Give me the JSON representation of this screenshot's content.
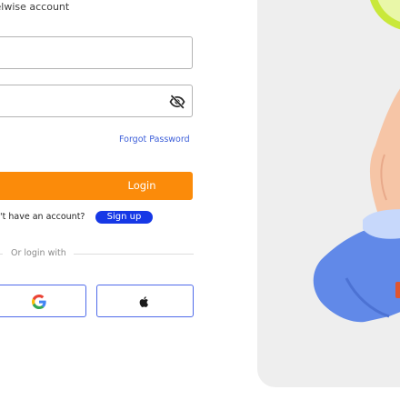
{
  "header": {
    "subtitle": "velwise  account"
  },
  "form": {
    "email_value": "",
    "password_value": "",
    "forgot_label": "Forgot Password",
    "login_label": "Login",
    "no_account_text": "n't have an account?",
    "signup_label": "Sign up",
    "divider_text": "Or login with"
  },
  "social": {
    "google_icon": "google-icon",
    "apple_icon": "apple-icon"
  },
  "colors": {
    "login_bg": "#fb8b0a",
    "signup_bg": "#1638e6",
    "link": "#3d5fd9",
    "social_border": "#4f6bea",
    "panel_bg": "#eeeeee"
  }
}
